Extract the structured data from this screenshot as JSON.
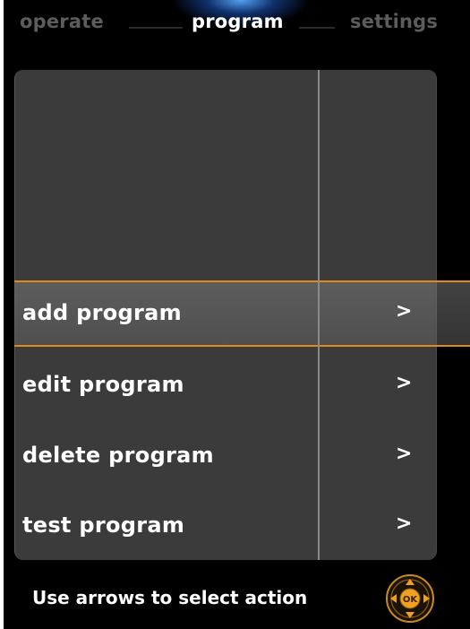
{
  "tabs": [
    {
      "label": "operate",
      "active": false
    },
    {
      "label": "program",
      "active": true
    },
    {
      "label": "settings",
      "active": false
    }
  ],
  "menu": {
    "items": [
      {
        "label": "add program",
        "arrow": ">",
        "selected": true
      },
      {
        "label": "edit program",
        "arrow": ">",
        "selected": false
      },
      {
        "label": "delete program",
        "arrow": ">",
        "selected": false
      },
      {
        "label": "test program",
        "arrow": ">",
        "selected": false
      }
    ]
  },
  "footer": {
    "hint": "Use arrows to select action",
    "ok_label": "OK",
    "ok_icon": "ok-dpad-icon"
  },
  "colors": {
    "background": "#000000",
    "panel": "#3b3b3b",
    "accent": "#e08a1e",
    "tab_active": "#ffffff",
    "tab_inactive": "#5c5c5c"
  }
}
